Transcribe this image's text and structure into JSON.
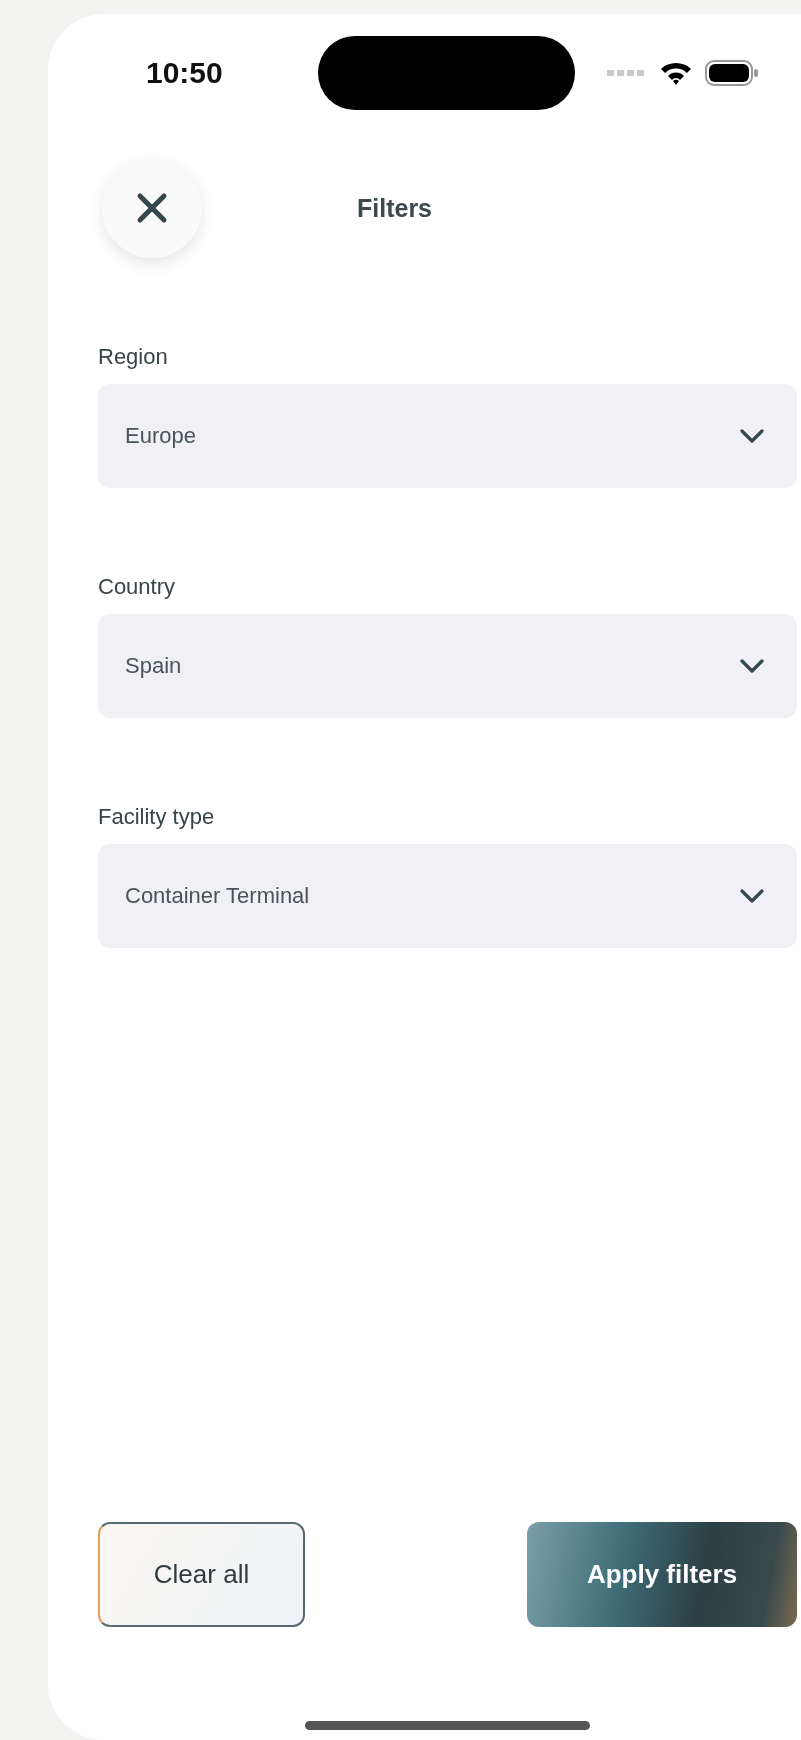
{
  "status_bar": {
    "time": "10:50"
  },
  "header": {
    "title": "Filters"
  },
  "filters": [
    {
      "label": "Region",
      "value": "Europe"
    },
    {
      "label": "Country",
      "value": "Spain"
    },
    {
      "label": "Facility type",
      "value": "Container Terminal"
    }
  ],
  "actions": [
    {
      "label": "Clear all",
      "kind": "secondary"
    },
    {
      "label": "Apply filters",
      "kind": "primary"
    }
  ]
}
